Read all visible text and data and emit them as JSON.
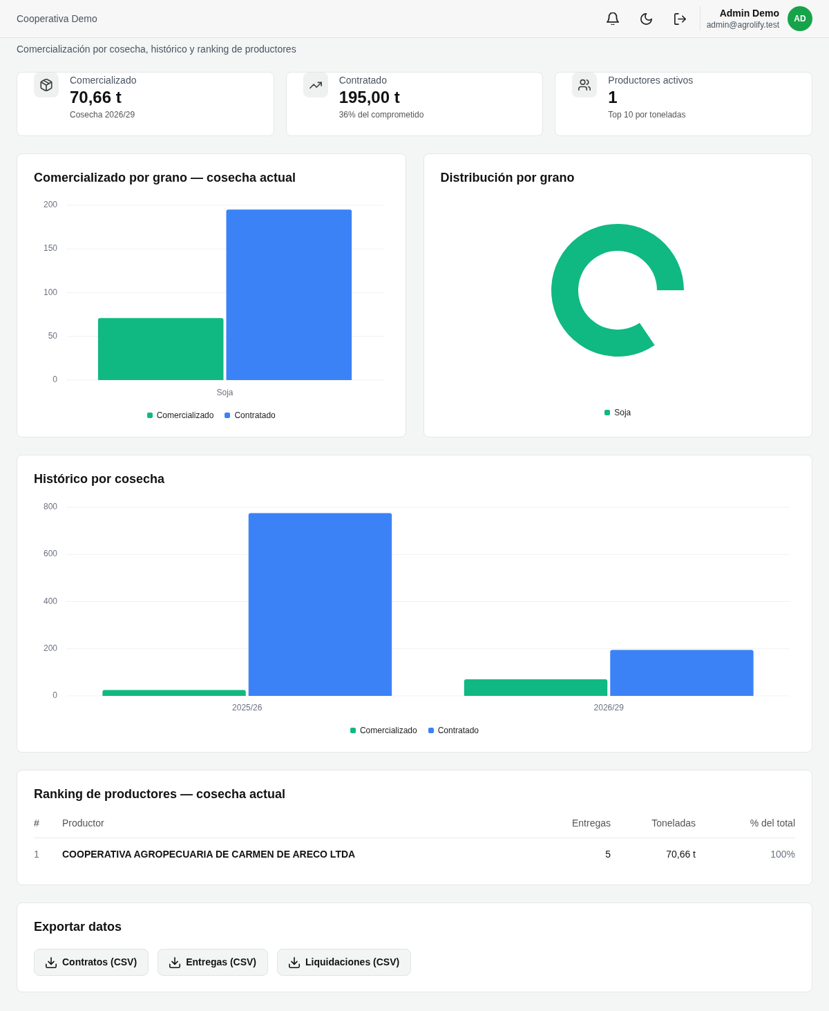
{
  "header": {
    "brand": "Cooperativa Demo",
    "user": {
      "name": "Admin Demo",
      "email": "admin@agrolify.test",
      "initials": "AD"
    }
  },
  "subtitle": "Comercialización por cosecha, histórico y ranking de productores",
  "stats": [
    {
      "label": "Comercializado",
      "value": "70,66 t",
      "note": "Cosecha 2026/29"
    },
    {
      "label": "Contratado",
      "value": "195,00 t",
      "note": "36% del comprometido"
    },
    {
      "label": "Productores activos",
      "value": "1",
      "note": "Top 10 por toneladas"
    }
  ],
  "by_grain": {
    "title": "Comercializado por grano — cosecha actual",
    "chart_data": {
      "type": "bar",
      "categories": [
        "Soja"
      ],
      "series": [
        {
          "name": "Comercializado",
          "color": "#10b981",
          "values": [
            71
          ]
        },
        {
          "name": "Contratado",
          "color": "#3b82f6",
          "values": [
            195
          ]
        }
      ],
      "ylim": [
        0,
        200
      ],
      "yticks": [
        0,
        50,
        100,
        150,
        200
      ],
      "grid": true
    }
  },
  "distribution": {
    "title": "Distribución por grano",
    "slices": [
      {
        "label": "Soja",
        "color": "#10b981"
      }
    ]
  },
  "history": {
    "title": "Histórico por cosecha",
    "chart_data": {
      "type": "bar",
      "categories": [
        "2025/26",
        "2026/29"
      ],
      "series": [
        {
          "name": "Comercializado",
          "color": "#10b981",
          "values": [
            25,
            70
          ]
        },
        {
          "name": "Contratado",
          "color": "#3b82f6",
          "values": [
            775,
            195
          ]
        }
      ],
      "ylim": [
        0,
        800
      ],
      "yticks": [
        0,
        200,
        400,
        600,
        800
      ],
      "grid": true
    }
  },
  "ranking": {
    "title": "Ranking de productores — cosecha actual",
    "columns": [
      "#",
      "Productor",
      "Entregas",
      "Toneladas",
      "% del total"
    ],
    "rows": [
      [
        "1",
        "COOPERATIVA AGROPECUARIA DE CARMEN DE ARECO LTDA",
        "5",
        "70,66 t",
        "100%"
      ]
    ]
  },
  "export": {
    "title": "Exportar datos",
    "buttons": [
      "Contratos (CSV)",
      "Entregas (CSV)",
      "Liquidaciones (CSV)"
    ]
  }
}
